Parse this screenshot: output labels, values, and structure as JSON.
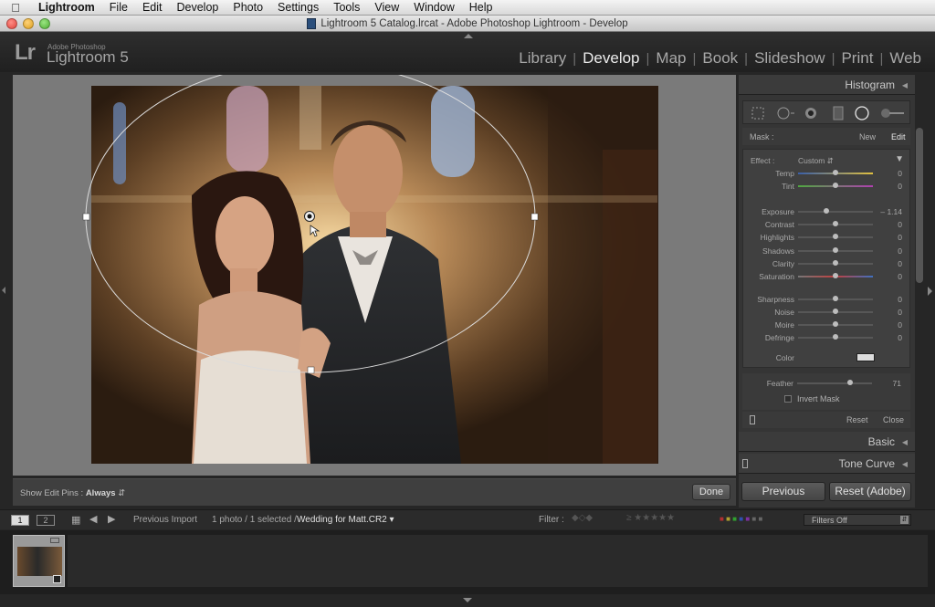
{
  "menubar": {
    "app": "Lightroom",
    "items": [
      "File",
      "Edit",
      "Develop",
      "Photo",
      "Settings",
      "Tools",
      "View",
      "Window",
      "Help"
    ]
  },
  "window": {
    "title": "Lightroom 5 Catalog.lrcat - Adobe Photoshop Lightroom - Develop"
  },
  "brand": {
    "logo": "Lr",
    "small": "Adobe Photoshop",
    "big": "Lightroom 5"
  },
  "modules": [
    "Library",
    "Develop",
    "Map",
    "Book",
    "Slideshow",
    "Print",
    "Web"
  ],
  "active_module": "Develop",
  "toolbar": {
    "show_edit_pins_label": "Show Edit Pins :",
    "show_edit_pins_value": "Always",
    "done_label": "Done"
  },
  "panel": {
    "histogram": "Histogram",
    "mask": {
      "label": "Mask :",
      "new": "New",
      "edit": "Edit"
    },
    "effect": {
      "label": "Effect :",
      "value": "Custom"
    },
    "sliders": [
      {
        "name": "Temp",
        "value": "0",
        "pos": 0.5
      },
      {
        "name": "Tint",
        "value": "0",
        "pos": 0.5
      },
      {
        "name": "Exposure",
        "value": "– 1.14",
        "pos": 0.38
      },
      {
        "name": "Contrast",
        "value": "0",
        "pos": 0.5
      },
      {
        "name": "Highlights",
        "value": "0",
        "pos": 0.5
      },
      {
        "name": "Shadows",
        "value": "0",
        "pos": 0.5
      },
      {
        "name": "Clarity",
        "value": "0",
        "pos": 0.5
      },
      {
        "name": "Saturation",
        "value": "0",
        "pos": 0.5
      },
      {
        "name": "Sharpness",
        "value": "0",
        "pos": 0.5
      },
      {
        "name": "Noise",
        "value": "0",
        "pos": 0.5
      },
      {
        "name": "Moire",
        "value": "0",
        "pos": 0.5
      },
      {
        "name": "Defringe",
        "value": "0",
        "pos": 0.5
      }
    ],
    "color_label": "Color",
    "feather": {
      "label": "Feather",
      "value": "71",
      "pos": 0.71
    },
    "invert_mask": "Invert Mask",
    "reset": "Reset",
    "close": "Close",
    "basic": "Basic",
    "tone_curve": "Tone Curve",
    "previous": "Previous",
    "reset_adobe": "Reset (Adobe)"
  },
  "filmbar": {
    "page1": "1",
    "page2": "2",
    "source": "Previous Import",
    "count": "1 photo / 1 selected /",
    "filename": "Wedding for Matt.CR2",
    "filter_label": "Filter :",
    "filters_value": "Filters Off"
  },
  "colors": {
    "bg": "#262626",
    "panel": "#353535",
    "canvas": "#7a7a7a",
    "accent": "#ececec"
  }
}
